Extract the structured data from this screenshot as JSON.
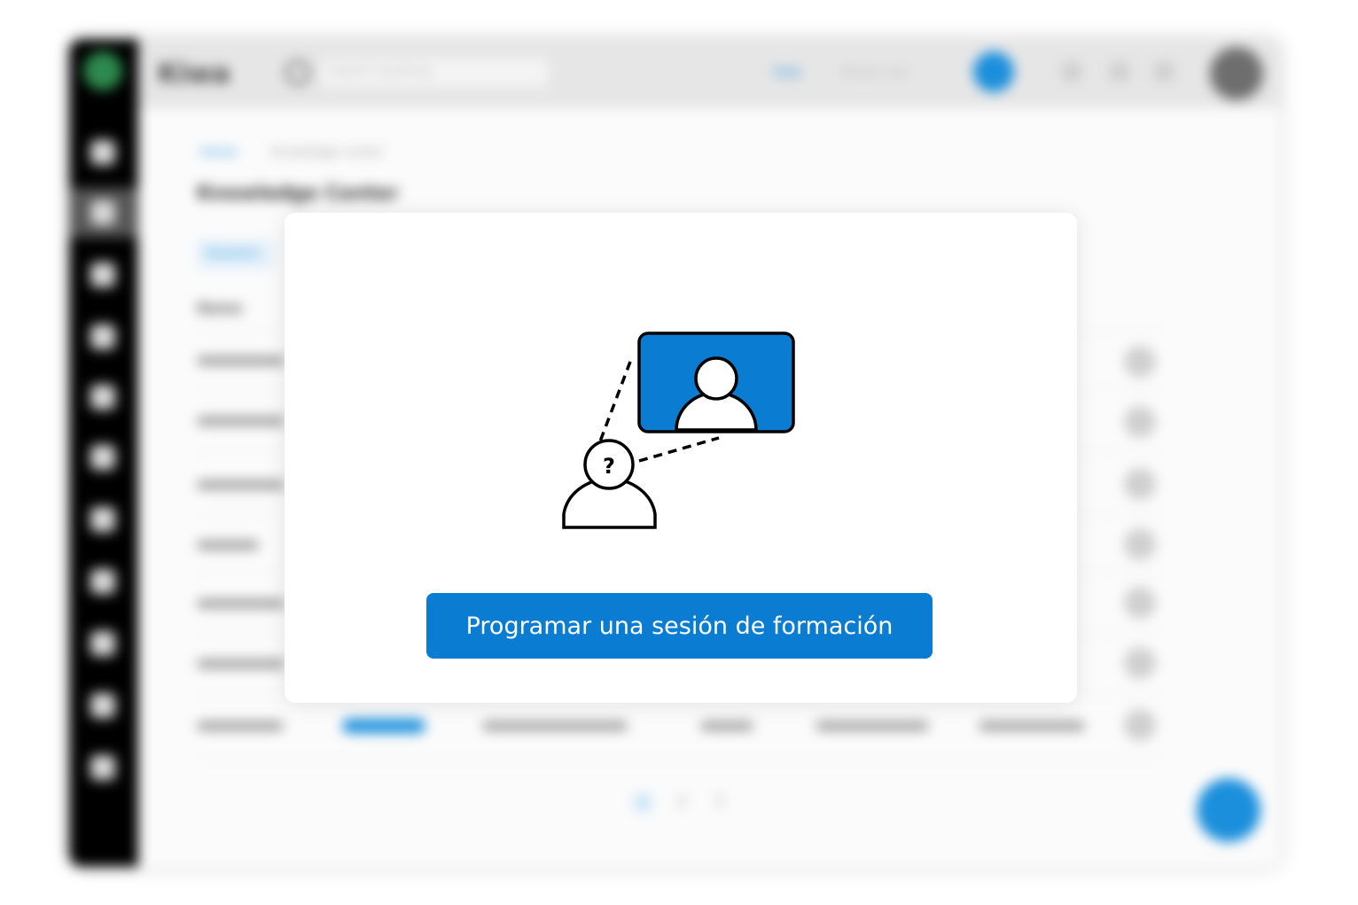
{
  "background": {
    "app_title": "Kiwa",
    "search_placeholder": "Search anything",
    "top_links": [
      "Help",
      "Whats new"
    ],
    "breadcrumb": [
      "Home",
      "Knowledge center"
    ],
    "page_title": "Knowledge Center",
    "tab_label": "Sessions",
    "column_header": "Name",
    "pagination": [
      "1",
      "2",
      "3"
    ]
  },
  "modal": {
    "cta_label": "Programar una sesión de formación",
    "illustration_question_mark": "?"
  },
  "colors": {
    "accent": "#0a7cd1",
    "sidebar": "#000000",
    "topbar": "#e6e6e6"
  },
  "icons": [
    "home-icon",
    "grid-icon",
    "document-icon",
    "pencil-icon",
    "user-icon",
    "calendar-icon",
    "chat-icon",
    "help-icon",
    "mail-icon",
    "chart-icon",
    "settings-icon",
    "search-icon",
    "video-call-icon",
    "question-user-icon"
  ]
}
